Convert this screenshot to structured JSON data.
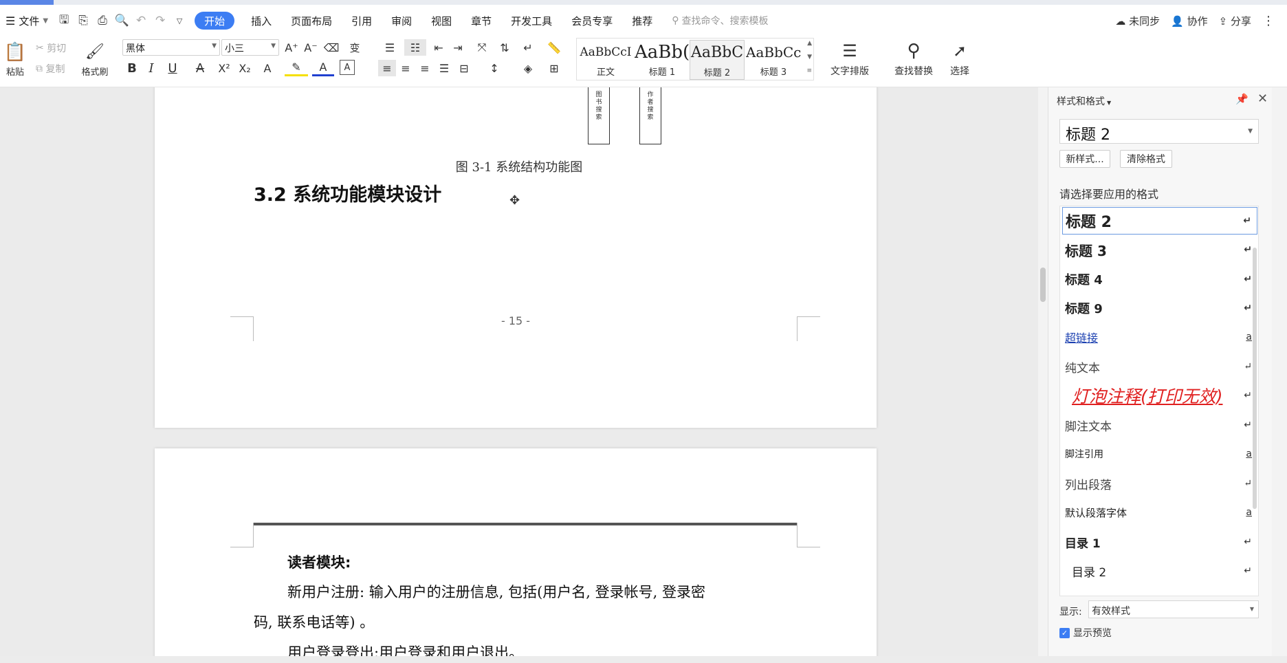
{
  "menubar": {
    "file": "文件",
    "tabs": [
      "开始",
      "插入",
      "页面布局",
      "引用",
      "审阅",
      "视图",
      "章节",
      "开发工具",
      "会员专享",
      "推荐"
    ],
    "search_placeholder": "查找命令、搜索模板",
    "sync": "未同步",
    "collab": "协作",
    "share": "分享"
  },
  "ribbon": {
    "paste": "粘贴",
    "cut": "剪切",
    "copy": "复制",
    "format_painter": "格式刷",
    "font_name": "黑体",
    "font_size": "小三",
    "styles_gallery": [
      {
        "preview": "AaBbCcI",
        "label": "正文"
      },
      {
        "preview": "AaBb(",
        "label": "标题 1"
      },
      {
        "preview": "AaBbC",
        "label": "标题 2"
      },
      {
        "preview": "AaBbCc",
        "label": "标题 3"
      }
    ],
    "text_layout": "文字排版",
    "find_replace": "查找替换",
    "select": "选择"
  },
  "document": {
    "box_labels": [
      "图书搜索",
      "作者搜索"
    ],
    "figure_caption": "图 3-1  系统结构功能图",
    "section_heading": "3.2  系统功能模块设计",
    "page_number": "- 15 -",
    "reader_module_title": "读者模块:",
    "para1": "新用户注册: 输入用户的注册信息, 包括(用户名, 登录帐号, 登录密",
    "para1_cont": "码, 联系电话等) 。",
    "para2": "用户登录登出:用户登录和用户退出。"
  },
  "panel": {
    "title": "样式和格式",
    "current_style": "标题  2",
    "new_style": "新样式...",
    "clear_format": "清除格式",
    "prompt": "请选择要应用的格式",
    "styles": [
      {
        "label": "标题  2",
        "mark": "↵"
      },
      {
        "label": "标题  3",
        "mark": "↵"
      },
      {
        "label": "标题  4",
        "mark": "↵"
      },
      {
        "label": "标题  9",
        "mark": "↵"
      },
      {
        "label": "超链接",
        "mark": "a"
      },
      {
        "label": "纯文本",
        "mark": "↵"
      },
      {
        "label": "灯泡注释(打印无效)",
        "mark": "↵"
      },
      {
        "label": "脚注文本",
        "mark": "↵"
      },
      {
        "label": "脚注引用",
        "mark": "a"
      },
      {
        "label": "列出段落",
        "mark": "↵"
      },
      {
        "label": "默认段落字体",
        "mark": "a"
      },
      {
        "label": "目录  1",
        "mark": "↵"
      },
      {
        "label": "目录  2",
        "mark": "↵"
      }
    ],
    "show_label": "显示:",
    "show_value": "有效样式",
    "preview_label": "显示预览"
  },
  "colors": {
    "accent": "#3c7df3",
    "bulb_note": "#e02020",
    "link": "#1a3fb0"
  }
}
